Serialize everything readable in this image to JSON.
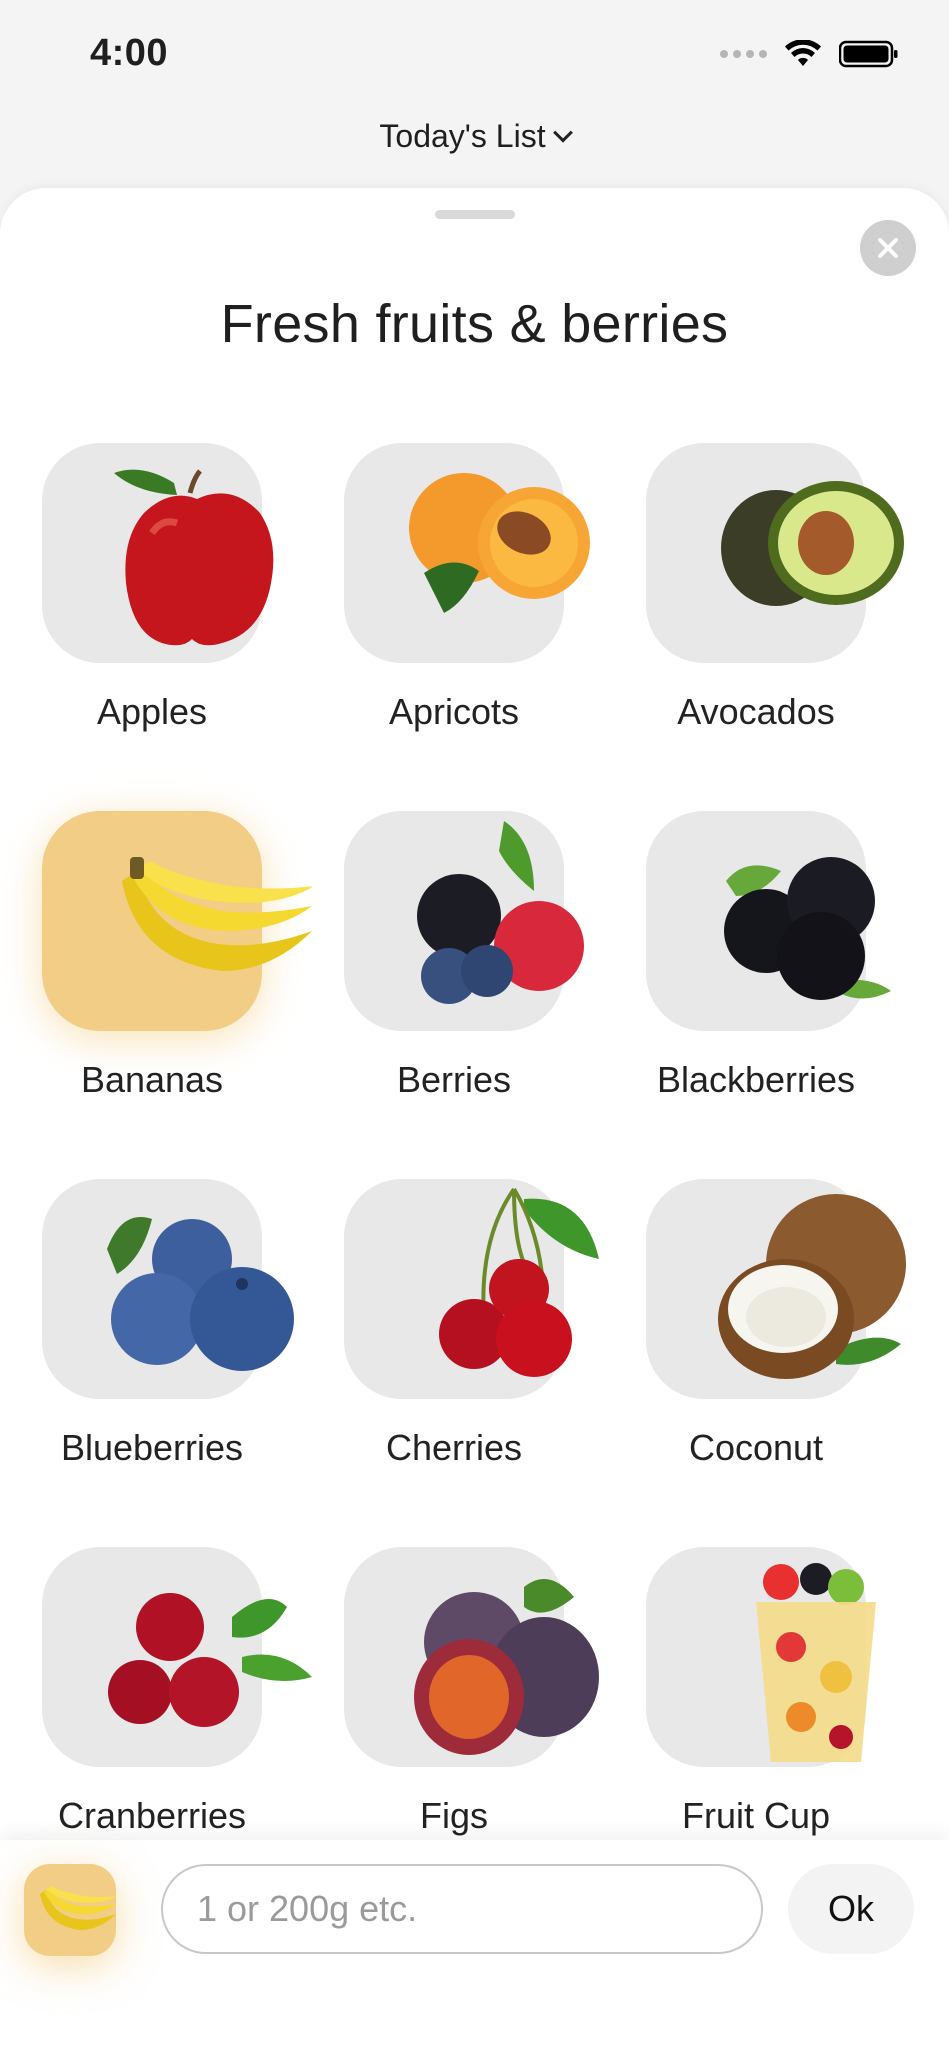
{
  "status_bar": {
    "time": "4:00"
  },
  "header": {
    "list_label": "Today's List"
  },
  "sheet": {
    "title": "Fresh fruits & berries"
  },
  "items": [
    {
      "label": "Apples",
      "icon": "apple-icon",
      "selected": false
    },
    {
      "label": "Apricots",
      "icon": "apricot-icon",
      "selected": false
    },
    {
      "label": "Avocados",
      "icon": "avocado-icon",
      "selected": false
    },
    {
      "label": "Bananas",
      "icon": "banana-icon",
      "selected": true
    },
    {
      "label": "Berries",
      "icon": "berries-icon",
      "selected": false
    },
    {
      "label": "Blackberries",
      "icon": "blackberry-icon",
      "selected": false
    },
    {
      "label": "Blueberries",
      "icon": "blueberry-icon",
      "selected": false
    },
    {
      "label": "Cherries",
      "icon": "cherry-icon",
      "selected": false
    },
    {
      "label": "Coconut",
      "icon": "coconut-icon",
      "selected": false
    },
    {
      "label": "Cranberries",
      "icon": "cranberry-icon",
      "selected": false
    },
    {
      "label": "Figs",
      "icon": "fig-icon",
      "selected": false
    },
    {
      "label": "Fruit Cup",
      "icon": "fruit-cup-icon",
      "selected": false
    }
  ],
  "bottom_bar": {
    "selected_item_icon": "banana-icon",
    "quantity_value": "",
    "quantity_placeholder": "1 or 200g etc.",
    "ok_label": "Ok"
  },
  "colors": {
    "selected_tile": "#f2cd86",
    "tile": "#e8e8e8",
    "close_button": "#cfcfcf"
  }
}
